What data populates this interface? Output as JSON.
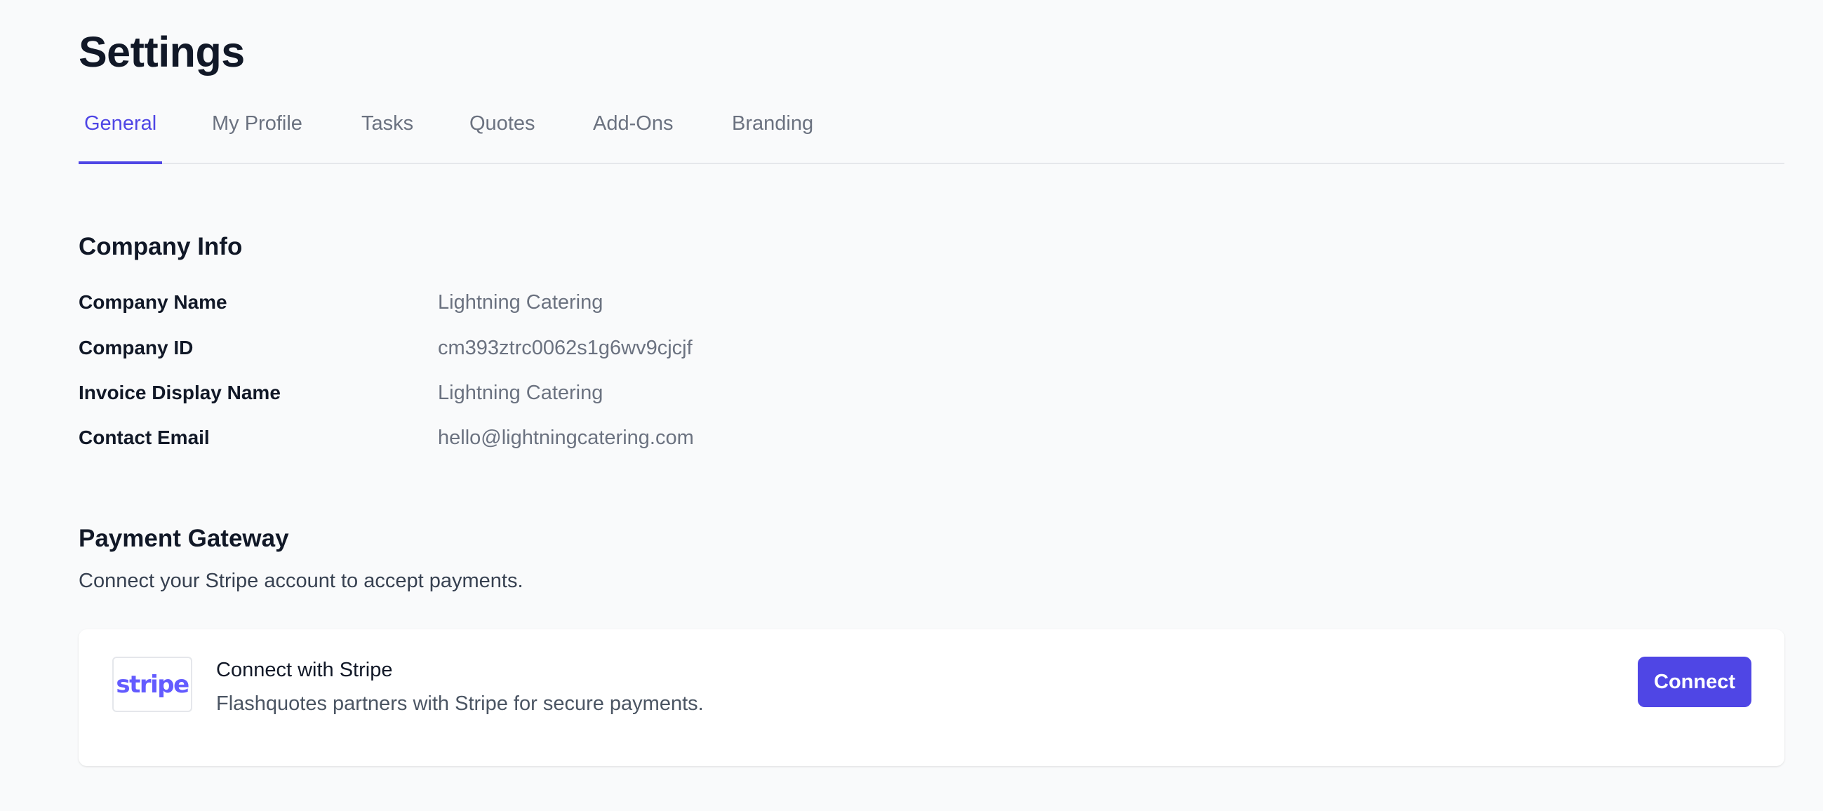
{
  "page": {
    "title": "Settings"
  },
  "tabs": [
    {
      "label": "General",
      "active": true
    },
    {
      "label": "My Profile",
      "active": false
    },
    {
      "label": "Tasks",
      "active": false
    },
    {
      "label": "Quotes",
      "active": false
    },
    {
      "label": "Add-Ons",
      "active": false
    },
    {
      "label": "Branding",
      "active": false
    }
  ],
  "company_info": {
    "title": "Company Info",
    "rows": [
      {
        "label": "Company Name",
        "value": "Lightning Catering"
      },
      {
        "label": "Company ID",
        "value": "cm393ztrc0062s1g6wv9cjcjf"
      },
      {
        "label": "Invoice Display Name",
        "value": "Lightning Catering"
      },
      {
        "label": "Contact Email",
        "value": "hello@lightningcatering.com"
      }
    ]
  },
  "payment_gateway": {
    "title": "Payment Gateway",
    "description": "Connect your Stripe account to accept payments.",
    "card": {
      "logo_text": "stripe",
      "title": "Connect with Stripe",
      "subtitle": "Flashquotes partners with Stripe for secure payments.",
      "button_label": "Connect"
    }
  },
  "colors": {
    "accent": "#4f46e5",
    "stripe_brand": "#635bff",
    "background": "#f9fafb"
  }
}
